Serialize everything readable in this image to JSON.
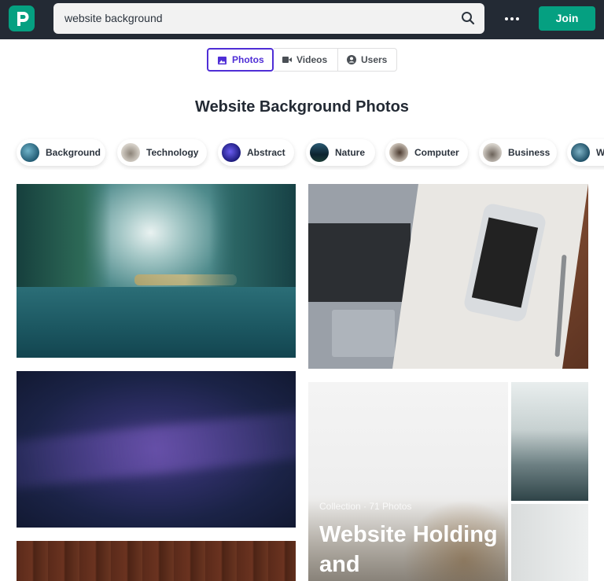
{
  "header": {
    "search_value": "website background",
    "join_label": "Join"
  },
  "tabs": [
    {
      "label": "Photos",
      "icon": "image-icon",
      "active": true
    },
    {
      "label": "Videos",
      "icon": "video-icon",
      "active": false
    },
    {
      "label": "Users",
      "icon": "user-icon",
      "active": false
    }
  ],
  "page_title": "Website Background Photos",
  "categories": [
    {
      "label": "Background"
    },
    {
      "label": "Technology"
    },
    {
      "label": "Abstract"
    },
    {
      "label": "Nature"
    },
    {
      "label": "Computer"
    },
    {
      "label": "Business"
    },
    {
      "label": "W"
    }
  ],
  "collection": {
    "meta": "Collection · 71 Photos",
    "title": "Website Holding and"
  },
  "colors": {
    "brand": "#05a081",
    "topbar": "#232a34",
    "active_tab": "#4f2ed6"
  }
}
